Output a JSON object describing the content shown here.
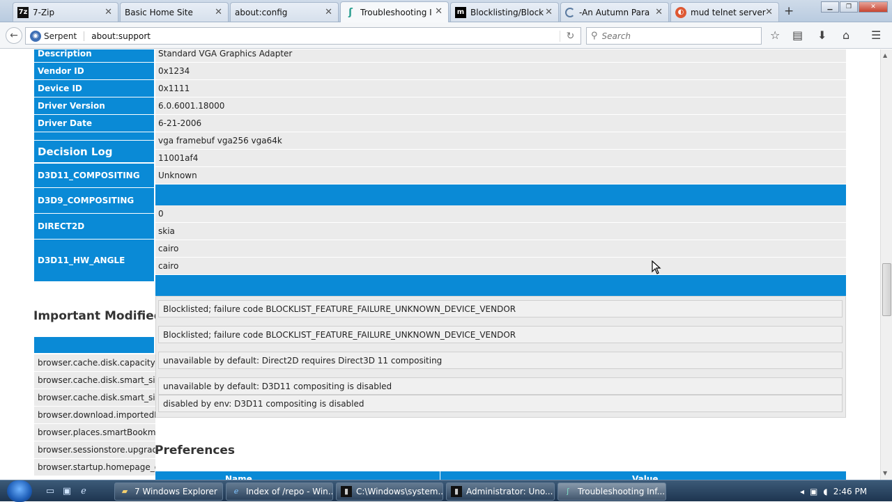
{
  "tabs": [
    {
      "label": "7-Zip",
      "icon": "7z"
    },
    {
      "label": "Basic Home Site",
      "icon": ""
    },
    {
      "label": "about:config",
      "icon": ""
    },
    {
      "label": "Troubleshooting I",
      "icon": "support"
    },
    {
      "label": "Blocklisting/Block",
      "icon": "m"
    },
    {
      "label": "-An Autumn Para",
      "icon": "loading"
    },
    {
      "label": "mud telnet server",
      "icon": "ddg"
    }
  ],
  "newtab_label": "+",
  "nav": {
    "identity": "Serpent",
    "url": "about:support",
    "search_placeholder": "Search"
  },
  "graphics_rows": [
    {
      "label": "Description",
      "value": "Standard VGA Graphics Adapter"
    },
    {
      "label": "Vendor ID",
      "value": "0x1234"
    },
    {
      "label": "Device ID",
      "value": "0x1111"
    },
    {
      "label": "Driver Version",
      "value": "6.0.6001.18000"
    },
    {
      "label": "Driver Date",
      "value": "6-21-2006"
    }
  ],
  "extra_values": [
    "vga framebuf vga256 vga64k",
    "11001af4",
    "Unknown"
  ],
  "decision_log_title": "Decision Log",
  "decision_labels": [
    "D3D11_COMPOSITING",
    "D3D9_COMPOSITING",
    "DIRECT2D",
    "D3D11_HW_ANGLE"
  ],
  "lower_values": [
    "0",
    "skia",
    "cairo",
    "cairo"
  ],
  "log_lines": [
    "Blocklisted; failure code BLOCKLIST_FEATURE_FAILURE_UNKNOWN_DEVICE_VENDOR",
    "Blocklisted; failure code BLOCKLIST_FEATURE_FAILURE_UNKNOWN_DEVICE_VENDOR",
    "unavailable by default: Direct2D requires Direct3D 11 compositing",
    "unavailable by default: D3D11 compositing is disabled",
    "disabled by env: D3D11 compositing is disabled"
  ],
  "important_modified_title": "Important Modified",
  "modified_prefs": [
    "browser.cache.disk.capacity",
    "browser.cache.disk.smart_size.fir",
    "browser.cache.disk.smart_size.us",
    "browser.download.importedFror",
    "browser.places.smartBookmarks",
    "browser.sessionstore.upgradeBa",
    "browser.startup.homepage_over"
  ],
  "preferences_title": "Preferences",
  "pref_table_headers": [
    "Name",
    "Value"
  ],
  "taskbar": {
    "buttons": [
      {
        "label": "7 Windows Explorer",
        "icon": "folder"
      },
      {
        "label": "Index of /repo - Win...",
        "icon": "ie"
      },
      {
        "label": "C:\\Windows\\system...",
        "icon": "cmd"
      },
      {
        "label": "Administrator: Uno...",
        "icon": "cmd"
      },
      {
        "label": "Troubleshooting Inf...",
        "icon": "support"
      }
    ],
    "clock": "2:46 PM"
  },
  "colors": {
    "accent": "#0a8ad6",
    "row_bg": "#ebebeb"
  }
}
